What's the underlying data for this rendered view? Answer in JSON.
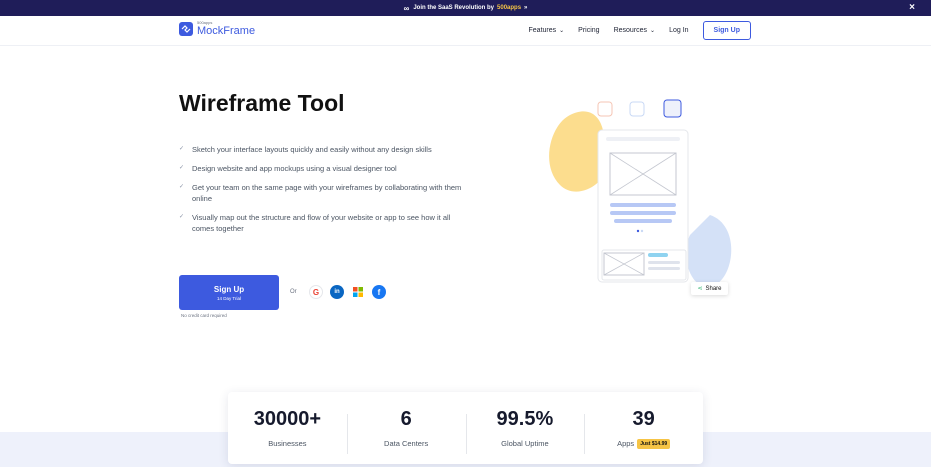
{
  "promo": {
    "text": "Join the SaaS Revolution by ",
    "highlight": "500apps",
    "arrow": "»",
    "close": "×"
  },
  "logo": {
    "sub": "500apps",
    "name": "MockFrame"
  },
  "nav": {
    "features": "Features",
    "pricing": "Pricing",
    "resources": "Resources",
    "login": "Log In",
    "signup": "Sign Up"
  },
  "hero": {
    "title": "Wireframe Tool",
    "features": [
      "Sketch your interface layouts quickly and easily without any design skills",
      "Design website and app mockups using a visual designer tool",
      "Get your team on the same page with your wireframes by collaborating with them online",
      "Visually map out the structure and flow of your website or app to see how it all comes together"
    ],
    "cta_label": "Sign Up",
    "cta_sub": "14 Day Trial",
    "no_card": "No credit card required",
    "or": "Or",
    "share": "Share"
  },
  "stats": [
    {
      "num": "30000+",
      "label": "Businesses"
    },
    {
      "num": "6",
      "label": "Data Centers"
    },
    {
      "num": "99.5%",
      "label": "Global Uptime"
    },
    {
      "num": "39",
      "label": "Apps",
      "badge": "Just $14.99"
    }
  ]
}
